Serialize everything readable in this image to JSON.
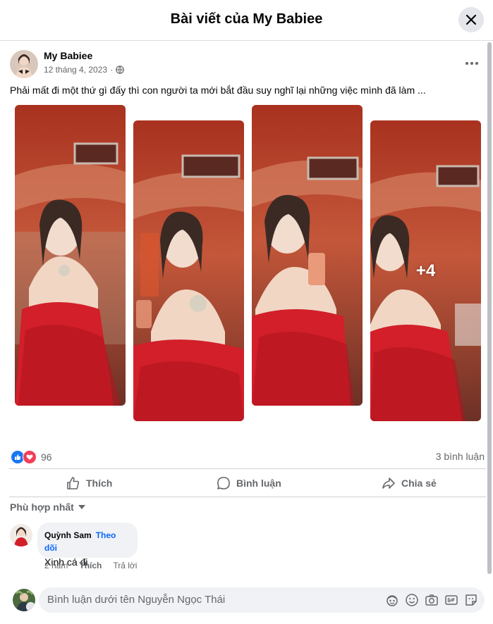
{
  "dialog": {
    "title": "Bài viết của My Babiee"
  },
  "post": {
    "author": "My Babiee",
    "date": "12 tháng 4, 2023",
    "separator": "·",
    "text": "Phải mất đi một thứ gì đấy thì con người ta mới bắt đầu suy nghĩ lại những việc mình đã làm ...",
    "more_photos": "+4"
  },
  "stats": {
    "reaction_count": "96",
    "comment_count": "3 bình luận"
  },
  "actions": {
    "like": "Thích",
    "comment": "Bình luận",
    "share": "Chia sẻ"
  },
  "comments_sort": "Phù hợp nhất",
  "comment": {
    "author": "Quỳnh Sam",
    "follow": "Theo dõi",
    "text": "Xinh cá đi",
    "time": "2 năm",
    "like": "Thích",
    "reply": "Trả lời"
  },
  "composer": {
    "placeholder": "Bình luận dưới tên Nguyễn Ngọc Thái"
  },
  "colors": {
    "accent": "#0866ff",
    "like_blue": "#1877f2",
    "love_red": "#f33e58",
    "dress_red": "#d21f2a"
  },
  "icons": [
    "close-icon",
    "globe-icon",
    "more-icon",
    "like-icon",
    "love-icon",
    "thumb-up-icon",
    "comment-icon",
    "share-icon",
    "chevron-down-icon",
    "avatar-icon",
    "sticker-icon",
    "emoji-icon",
    "camera-icon",
    "gif-icon",
    "avatar-sticker-icon"
  ]
}
